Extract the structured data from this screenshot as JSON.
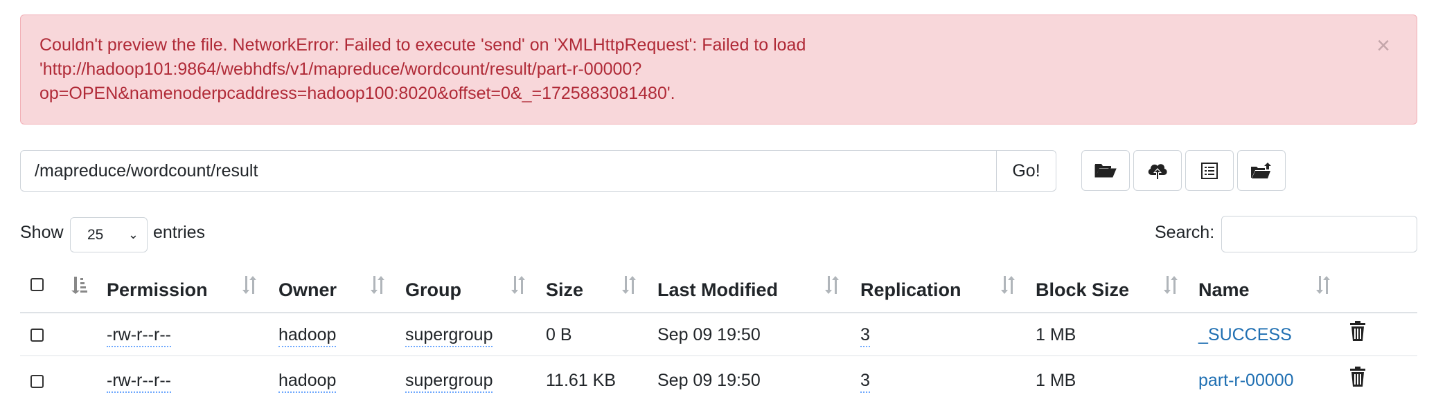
{
  "alert": {
    "lines": [
      "Couldn't preview the file. NetworkError: Failed to execute 'send' on 'XMLHttpRequest': Failed to load",
      "'http://hadoop101:9864/webhdfs/v1/mapreduce/wordcount/result/part-r-00000?",
      "op=OPEN&namenoderpcaddress=hadoop100:8020&offset=0&_=1725883081480'."
    ],
    "close_symbol": "×"
  },
  "path_bar": {
    "path_value": "/mapreduce/wordcount/result",
    "go_label": "Go!"
  },
  "toolbar": {
    "buttons": [
      "folder-open-icon",
      "cloud-upload-icon",
      "list-alt-icon",
      "folder-move-icon"
    ]
  },
  "table_controls": {
    "show_label": "Show",
    "page_length": "25",
    "entries_label": "entries",
    "search_label": "Search:",
    "search_value": ""
  },
  "table": {
    "columns": [
      "Permission",
      "Owner",
      "Group",
      "Size",
      "Last Modified",
      "Replication",
      "Block Size",
      "Name"
    ],
    "rows": [
      {
        "permission": "-rw-r--r--",
        "owner": "hadoop",
        "group": "supergroup",
        "size": "0 B",
        "modified": "Sep 09 19:50",
        "replication": "3",
        "block_size": "1 MB",
        "name": "_SUCCESS"
      },
      {
        "permission": "-rw-r--r--",
        "owner": "hadoop",
        "group": "supergroup",
        "size": "11.61 KB",
        "modified": "Sep 09 19:50",
        "replication": "3",
        "block_size": "1 MB",
        "name": "part-r-00000"
      }
    ]
  },
  "colors": {
    "alert_bg": "#f8d7da",
    "alert_text": "#b02a37",
    "link": "#1f6fb2"
  }
}
